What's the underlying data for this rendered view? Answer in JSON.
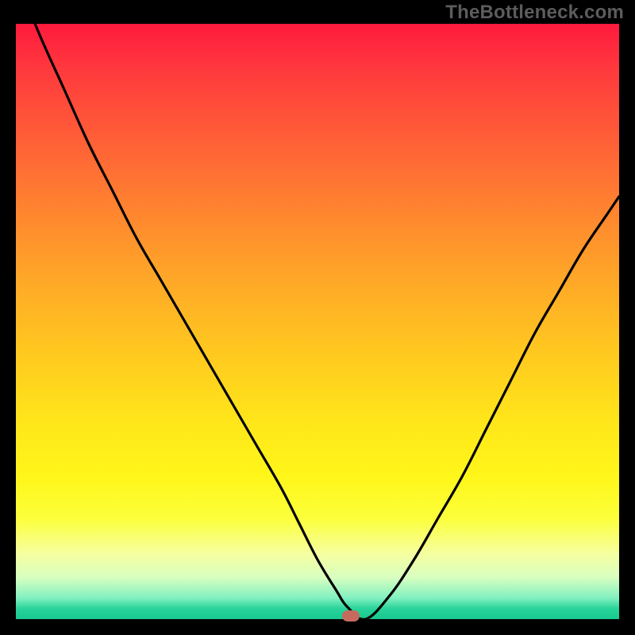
{
  "watermark": {
    "text": "TheBottleneck.com"
  },
  "chart_data": {
    "type": "line",
    "title": "",
    "xlabel": "",
    "ylabel": "",
    "xlim": [
      0,
      100
    ],
    "ylim": [
      0,
      100
    ],
    "background": "vertical-gradient red→yellow→green (top=high bottleneck, bottom=balanced)",
    "series": [
      {
        "name": "bottleneck-curve",
        "x": [
          0,
          4,
          8,
          12,
          16,
          20,
          24,
          28,
          32,
          36,
          40,
          44,
          47,
          50,
          53,
          55,
          58,
          62,
          66,
          70,
          74,
          78,
          82,
          86,
          90,
          94,
          98,
          100
        ],
        "y": [
          108,
          98,
          89,
          80,
          72,
          64,
          57,
          50,
          43,
          36,
          29,
          22,
          16,
          10,
          5,
          2,
          0,
          4,
          10,
          17,
          24,
          32,
          40,
          48,
          55,
          62,
          68,
          71
        ]
      }
    ],
    "marker": {
      "x": 55.5,
      "y": 0,
      "shape": "rounded-rect",
      "color": "#c76a5e"
    },
    "valley_flat_range_x": [
      50,
      56
    ]
  }
}
